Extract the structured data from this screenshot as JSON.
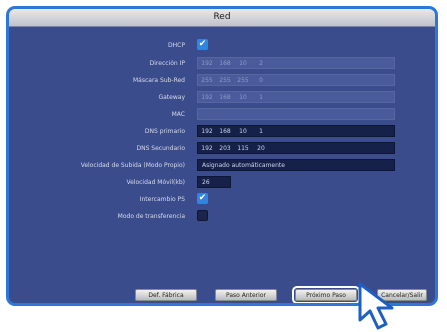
{
  "window": {
    "title": "Red"
  },
  "rows": [
    {
      "label": "DHCP",
      "type": "check",
      "checked": true
    },
    {
      "label": "Dirección IP",
      "type": "ip",
      "octets": [
        "192",
        "168",
        "10",
        "2"
      ],
      "dim": true
    },
    {
      "label": "Máscara Sub-Red",
      "type": "ip",
      "octets": [
        "255",
        "255",
        "255",
        "0"
      ],
      "dim": true
    },
    {
      "label": "Gateway",
      "type": "ip",
      "octets": [
        "192",
        "168",
        "10",
        "1"
      ],
      "dim": true
    },
    {
      "label": "MAC",
      "type": "ip",
      "octets": [
        "",
        "",
        "",
        ""
      ],
      "dim": true
    },
    {
      "label": "DNS primario",
      "type": "ip",
      "octets": [
        "192",
        "168",
        "10",
        "1"
      ],
      "dim": false
    },
    {
      "label": "DNS Secundario",
      "type": "ip",
      "octets": [
        "192",
        "203",
        "115",
        "20"
      ],
      "dim": false
    },
    {
      "label": "Velocidad de Subida (Modo Propio)",
      "type": "text",
      "value": "Asignado automáticamente",
      "small": false
    },
    {
      "label": "Velocidad Móvil(kb)",
      "type": "text",
      "value": "26",
      "small": true
    },
    {
      "label": "Intercambio PS",
      "type": "check",
      "checked": true
    },
    {
      "label": "Modo de transferencia",
      "type": "check",
      "checked": false
    }
  ],
  "buttons": [
    {
      "label": "Def. Fábrica",
      "highlighted": false
    },
    {
      "label": "Paso Anterior",
      "highlighted": false
    },
    {
      "label": "Próximo Paso",
      "highlighted": true
    },
    {
      "label": "Cancelar/Salir",
      "highlighted": false
    }
  ]
}
